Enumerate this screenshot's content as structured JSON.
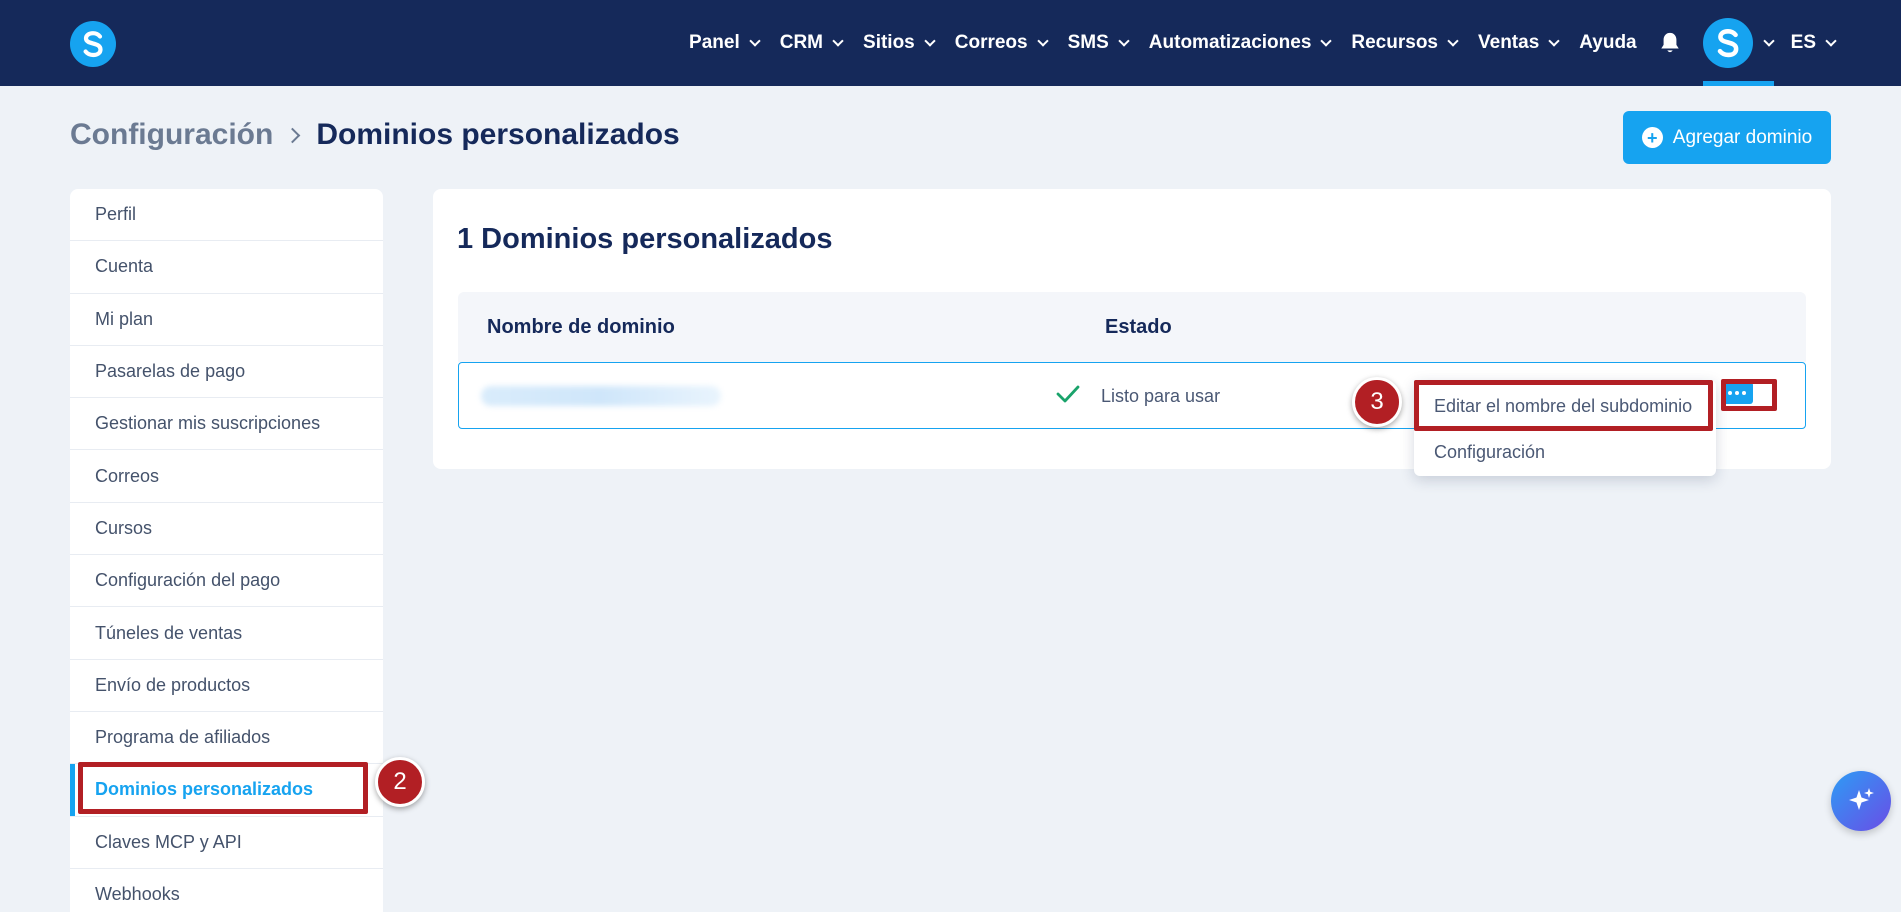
{
  "nav": {
    "items": [
      {
        "label": "Panel",
        "dropdown": true
      },
      {
        "label": "CRM",
        "dropdown": true
      },
      {
        "label": "Sitios",
        "dropdown": true
      },
      {
        "label": "Correos",
        "dropdown": true
      },
      {
        "label": "SMS",
        "dropdown": true
      },
      {
        "label": "Automatizaciones",
        "dropdown": true
      },
      {
        "label": "Recursos",
        "dropdown": true
      },
      {
        "label": "Ventas",
        "dropdown": true
      },
      {
        "label": "Ayuda",
        "dropdown": false
      }
    ],
    "language": "ES",
    "icons": {
      "logo": "systeme-logo-icon",
      "bell": "bell-icon",
      "avatar": "user-avatar-icon"
    }
  },
  "header": {
    "breadcrumb_root": "Configuración",
    "breadcrumb_current": "Dominios personalizados",
    "add_button_label": "Agregar dominio"
  },
  "sidebar": {
    "items": [
      {
        "label": "Perfil",
        "active": false
      },
      {
        "label": "Cuenta",
        "active": false
      },
      {
        "label": "Mi plan",
        "active": false
      },
      {
        "label": "Pasarelas de pago",
        "active": false
      },
      {
        "label": "Gestionar mis suscripciones",
        "active": false
      },
      {
        "label": "Correos",
        "active": false
      },
      {
        "label": "Cursos",
        "active": false
      },
      {
        "label": "Configuración del pago",
        "active": false
      },
      {
        "label": "Túneles de ventas",
        "active": false
      },
      {
        "label": "Envío de productos",
        "active": false
      },
      {
        "label": "Programa de afiliados",
        "active": false
      },
      {
        "label": "Dominios personalizados",
        "active": true
      },
      {
        "label": "Claves MCP y API",
        "active": false
      },
      {
        "label": "Webhooks",
        "active": false
      }
    ]
  },
  "main": {
    "title": "1 Dominios personalizados",
    "columns": [
      "Nombre de dominio",
      "Estado"
    ],
    "rows": [
      {
        "domain": "",
        "domain_blurred": true,
        "status": "Listo para usar",
        "status_icon": "check-icon"
      }
    ],
    "row_menu": {
      "items": [
        "Editar el nombre del subdominio",
        "Configuración"
      ]
    }
  },
  "annotations": {
    "step_2": "2",
    "step_3": "3",
    "color": "#b21f24"
  },
  "colors": {
    "topbar": "#15295a",
    "accent": "#16a3f0",
    "background": "#eef2f7",
    "success": "#1aa36b"
  }
}
